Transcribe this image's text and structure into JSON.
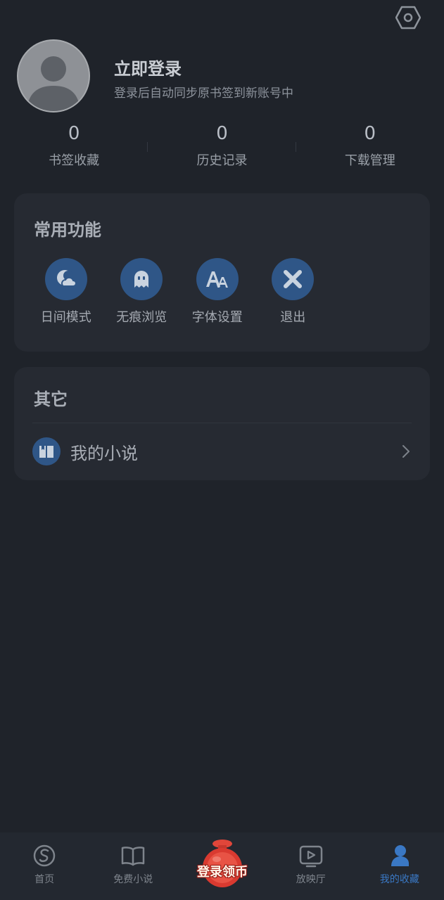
{
  "header": {
    "settings_icon": "settings-hexagon-icon"
  },
  "profile": {
    "login_title": "立即登录",
    "login_subtitle": "登录后自动同步原书签到新账号中",
    "avatar_icon": "user-avatar-icon"
  },
  "stats": [
    {
      "value": "0",
      "label": "书签收藏"
    },
    {
      "value": "0",
      "label": "历史记录"
    },
    {
      "value": "0",
      "label": "下载管理"
    }
  ],
  "functions": {
    "title": "常用功能",
    "items": [
      {
        "label": "日间模式",
        "icon": "day-mode-icon"
      },
      {
        "label": "无痕浏览",
        "icon": "ghost-icon"
      },
      {
        "label": "字体设置",
        "icon": "font-icon"
      },
      {
        "label": "退出",
        "icon": "close-icon"
      }
    ]
  },
  "other": {
    "title": "其它",
    "items": [
      {
        "label": "我的小说",
        "icon": "book-icon"
      }
    ]
  },
  "tabbar": {
    "items": [
      {
        "label": "首页",
        "icon": "home-s-icon",
        "active": false
      },
      {
        "label": "免费小说",
        "icon": "open-book-icon",
        "active": false
      },
      {
        "label": "",
        "icon": "promo-badge-icon",
        "active": false
      },
      {
        "label": "放映厅",
        "icon": "play-icon",
        "active": false
      },
      {
        "label": "我的收藏",
        "icon": "profile-icon",
        "active": true
      }
    ],
    "promo_text": "登录领币"
  },
  "colors": {
    "background": "#1f232a",
    "card": "#262a32",
    "accent": "#3a78c4",
    "icon_circle": "#2f5687"
  }
}
